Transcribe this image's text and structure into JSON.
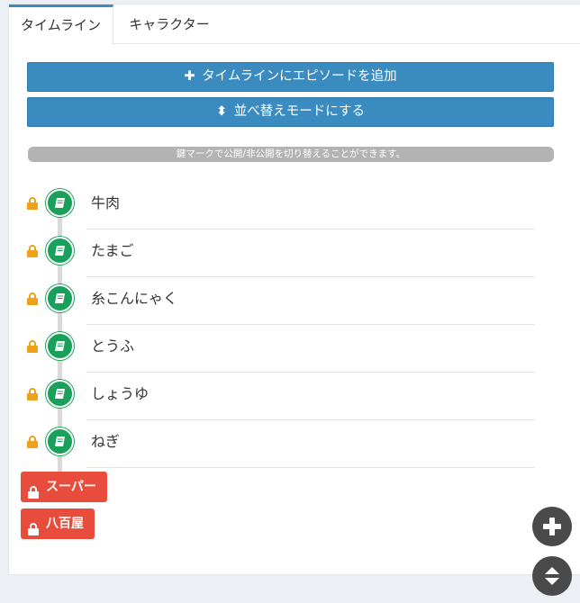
{
  "tabs": {
    "timeline": "タイムライン",
    "character": "キャラクター"
  },
  "buttons": {
    "add_episode": "タイムラインにエピソードを追加",
    "sort_mode": "並べ替えモードにする"
  },
  "notice": "鍵マークで公開/非公開を切り替えることができます。",
  "timeline": {
    "items": [
      {
        "label": "牛肉"
      },
      {
        "label": "たまご"
      },
      {
        "label": "糸こんにゃく"
      },
      {
        "label": "とうふ"
      },
      {
        "label": "しょうゆ"
      },
      {
        "label": "ねぎ"
      }
    ],
    "tags": [
      {
        "label": "スーパー"
      },
      {
        "label": "八百屋"
      }
    ]
  },
  "colors": {
    "primary": "#3a8bc0",
    "item_icon": "#19a05a",
    "tag": "#e74c3c",
    "lock": "#f0a11c",
    "fab": "#4a4a4a"
  }
}
